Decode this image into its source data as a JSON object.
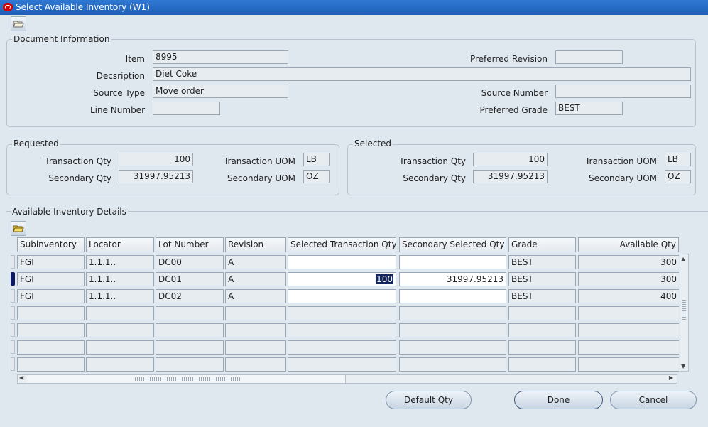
{
  "window": {
    "title": "Select Available Inventory (W1)"
  },
  "doc": {
    "group_title": "Document Information",
    "item_label": "Item",
    "item_value": "8995",
    "desc_label": "Decsription",
    "desc_value": "Diet Coke",
    "source_type_label": "Source Type",
    "source_type_value": "Move order",
    "line_number_label": "Line Number",
    "line_number_value": "",
    "pref_rev_label": "Preferred Revision",
    "pref_rev_value": "",
    "source_number_label": "Source Number",
    "source_number_value": "",
    "pref_grade_label": "Preferred Grade",
    "pref_grade_value": "BEST"
  },
  "requested": {
    "group_title": "Requested",
    "txn_qty_label": "Transaction Qty",
    "txn_qty": "100",
    "sec_qty_label": "Secondary Qty",
    "sec_qty": "31997.95213",
    "txn_uom_label": "Transaction UOM",
    "txn_uom": "LB",
    "sec_uom_label": "Secondary UOM",
    "sec_uom": "OZ"
  },
  "selected": {
    "group_title": "Selected",
    "txn_qty_label": "Transaction Qty",
    "txn_qty": "100",
    "sec_qty_label": "Secondary Qty",
    "sec_qty": "31997.95213",
    "txn_uom_label": "Transaction UOM",
    "txn_uom": "LB",
    "sec_uom_label": "Secondary UOM",
    "sec_uom": "OZ"
  },
  "details": {
    "group_title": "Available Inventory Details",
    "columns": [
      "Subinventory",
      "Locator",
      "Lot Number",
      "Revision",
      "Selected Transaction Qty",
      "Secondary Selected Qty",
      "Grade",
      "Available Qty"
    ],
    "rows": [
      [
        "FGI",
        "1.1.1..",
        "DC00",
        "A",
        "",
        "",
        "BEST",
        "300"
      ],
      [
        "FGI",
        "1.1.1..",
        "DC01",
        "A",
        "100",
        "31997.95213",
        "BEST",
        "300"
      ],
      [
        "FGI",
        "1.1.1..",
        "DC02",
        "A",
        "",
        "",
        "BEST",
        "400"
      ],
      [
        "",
        "",
        "",
        "",
        "",
        "",
        "",
        ""
      ],
      [
        "",
        "",
        "",
        "",
        "",
        "",
        "",
        ""
      ],
      [
        "",
        "",
        "",
        "",
        "",
        "",
        "",
        ""
      ],
      [
        "",
        "",
        "",
        "",
        "",
        "",
        "",
        ""
      ]
    ],
    "current_row": 1
  },
  "buttons": {
    "default_qty": "Default Qty",
    "done": "Done",
    "cancel": "Cancel"
  }
}
